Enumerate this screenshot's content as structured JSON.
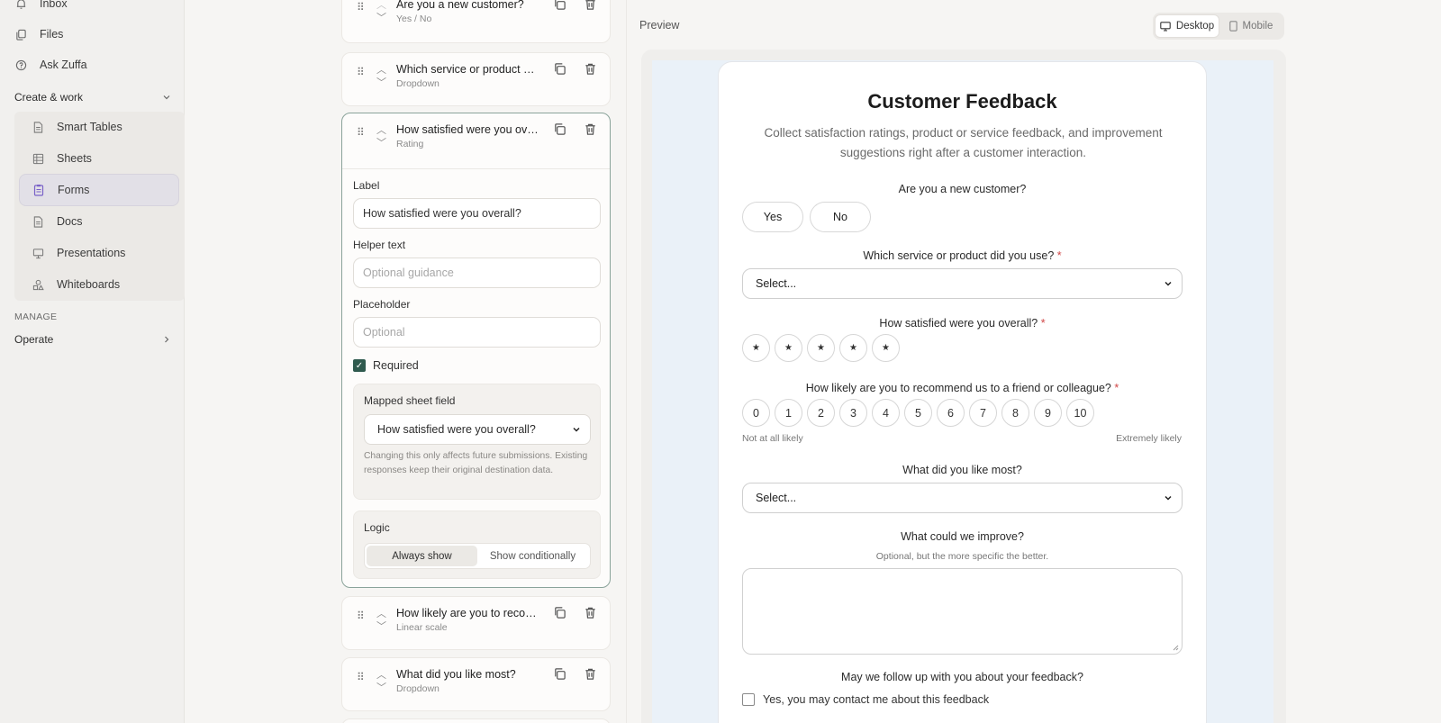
{
  "sidebar": {
    "top_items": [
      {
        "label": "Inbox",
        "icon": "bell-icon"
      },
      {
        "label": "Files",
        "icon": "files-icon"
      },
      {
        "label": "Ask Zuffa",
        "icon": "help-circle-icon"
      }
    ],
    "group_label": "Create & work",
    "sub_items": [
      {
        "label": "Smart Tables",
        "icon": "document-icon"
      },
      {
        "label": "Sheets",
        "icon": "grid-icon"
      },
      {
        "label": "Forms",
        "icon": "clipboard-icon"
      },
      {
        "label": "Docs",
        "icon": "document-icon"
      },
      {
        "label": "Presentations",
        "icon": "presentation-icon"
      },
      {
        "label": "Whiteboards",
        "icon": "shapes-icon"
      }
    ],
    "manage_label": "MANAGE",
    "operate_label": "Operate"
  },
  "questions": [
    {
      "title": "Are you a new customer?",
      "type": "Yes / No"
    },
    {
      "title": "Which service or product did you use?",
      "type": "Dropdown"
    },
    {
      "title": "How satisfied were you overall?",
      "type": "Rating"
    },
    {
      "title": "How likely are you to recommend us to a friend or colleague?",
      "type": "Linear scale"
    },
    {
      "title": "What did you like most?",
      "type": "Dropdown"
    }
  ],
  "editor": {
    "label_label": "Label",
    "label_value": "How satisfied were you overall?",
    "helper_label": "Helper text",
    "helper_placeholder": "Optional guidance",
    "placeholder_label": "Placeholder",
    "placeholder_placeholder": "Optional",
    "required_label": "Required",
    "required_checked": true,
    "mapped_label": "Mapped sheet field",
    "mapped_value": "How satisfied were you overall?",
    "mapped_note": "Changing this only affects future submissions. Existing responses keep their original destination data.",
    "logic_label": "Logic",
    "logic_options": [
      "Always show",
      "Show conditionally"
    ],
    "logic_selected": "Always show"
  },
  "preview": {
    "label": "Preview",
    "devices": [
      "Desktop",
      "Mobile"
    ],
    "selected_device": "Desktop"
  },
  "form": {
    "title": "Customer Feedback",
    "description": "Collect satisfaction ratings, product or service feedback, and improvement suggestions right after a customer interaction.",
    "q1": {
      "label": "Are you a new customer?",
      "options": [
        "Yes",
        "No"
      ]
    },
    "q2": {
      "label": "Which service or product did you use?",
      "required_mark": "*",
      "select_value": "Select..."
    },
    "q3": {
      "label": "How satisfied were you overall?",
      "required_mark": "*",
      "stars": 5,
      "star_glyph": "★"
    },
    "q4": {
      "label": "How likely are you to recommend us to a friend or colleague?",
      "required_mark": "*",
      "scale": [
        "0",
        "1",
        "2",
        "3",
        "4",
        "5",
        "6",
        "7",
        "8",
        "9",
        "10"
      ],
      "low_label": "Not at all likely",
      "high_label": "Extremely likely"
    },
    "q5": {
      "label": "What did you like most?",
      "select_value": "Select..."
    },
    "q6": {
      "label": "What could we improve?",
      "helper": "Optional, but the more specific the better."
    },
    "q7": {
      "label": "May we follow up with you about your feedback?",
      "checkbox_label": "Yes, you may contact me about this feedback"
    }
  },
  "colors": {
    "accent_green": "#2f5a4e",
    "required_red": "#d04545",
    "forms_icon_purple": "#7a62c8",
    "preview_canvas": "#eaf1f8"
  }
}
